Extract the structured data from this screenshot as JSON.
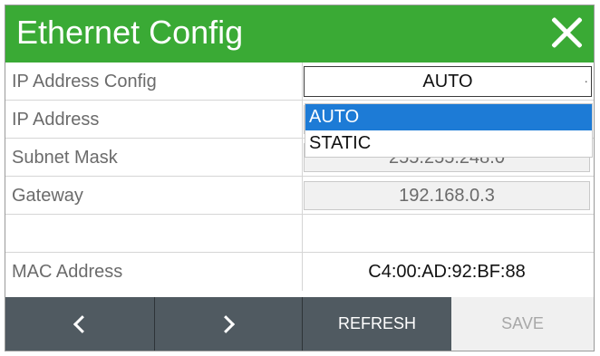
{
  "window": {
    "title": "Ethernet Config"
  },
  "rows": [
    {
      "label": "IP Address Config",
      "value": "AUTO",
      "kind": "select"
    },
    {
      "label": "IP Address",
      "value": "",
      "kind": "field"
    },
    {
      "label": "Subnet Mask",
      "value": "255.255.248.0",
      "kind": "field"
    },
    {
      "label": "Gateway",
      "value": "192.168.0.3",
      "kind": "field"
    },
    {
      "label": "",
      "value": "",
      "kind": "empty"
    },
    {
      "label": "MAC Address",
      "value": "C4:00:AD:92:BF:88",
      "kind": "text"
    }
  ],
  "dropdown": {
    "options": [
      "AUTO",
      "STATIC"
    ],
    "selected": "AUTO"
  },
  "buttons": {
    "refresh": "REFRESH",
    "save": "SAVE"
  },
  "colors": {
    "titlebar": "#3aaa35",
    "selection": "#1d7bd6",
    "button_dark": "#505a61"
  },
  "icons": {
    "close": "close-icon",
    "prev": "chevron-left-icon",
    "next": "chevron-right-icon"
  }
}
